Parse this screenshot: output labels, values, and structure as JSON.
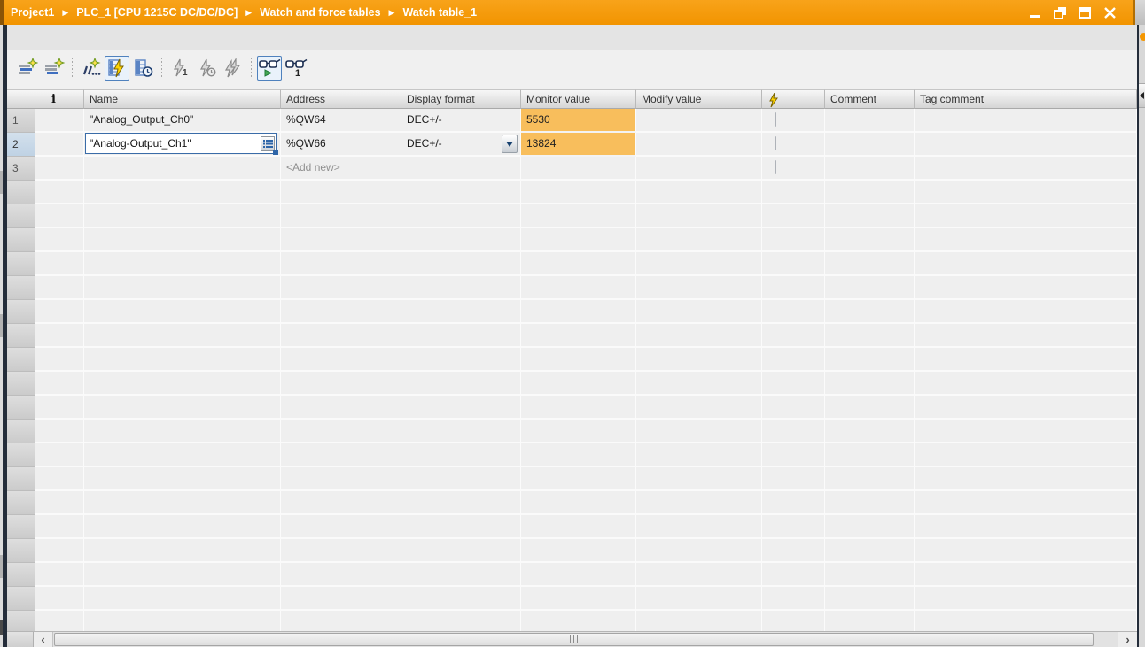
{
  "titlebar": {
    "breadcrumb": [
      "Project1",
      "PLC_1 [CPU 1215C DC/DC/DC]",
      "Watch and force tables",
      "Watch table_1"
    ],
    "separator": "▶"
  },
  "toolbar": {
    "buttons": [
      {
        "name": "insert-row",
        "icon": "rows-with-star-icon",
        "active": false
      },
      {
        "name": "add-row",
        "icon": "rows-with-star-icon",
        "active": false
      },
      {
        "name": "insert-multiple-rows",
        "icon": "italic-ll-dots-star-icon",
        "active": false
      },
      {
        "name": "monitor-all",
        "icon": "table-lightning-icon",
        "active": true
      },
      {
        "name": "monitor-once",
        "icon": "table-clock-icon",
        "active": false
      },
      {
        "name": "modify-once",
        "icon": "lightning-1-icon",
        "active": false
      },
      {
        "name": "modify-with-trigger",
        "icon": "lightning-clock-icon",
        "active": false
      },
      {
        "name": "modify-all",
        "icon": "double-lightning-icon",
        "active": false
      },
      {
        "name": "show-expanded-mode",
        "icon": "glasses-play-icon",
        "active": true
      },
      {
        "name": "show-force-columns",
        "icon": "glasses-1-icon",
        "active": false
      }
    ]
  },
  "table": {
    "headers": {
      "info": "i",
      "name": "Name",
      "address": "Address",
      "display_format": "Display format",
      "monitor_value": "Monitor value",
      "modify_value": "Modify value",
      "modify_trigger": "lightning-icon",
      "comment": "Comment",
      "tag_comment": "Tag comment"
    },
    "rows": [
      {
        "num": "1",
        "name": "\"Analog_Output_Ch0\"",
        "address": "%QW64",
        "display_format": "DEC+/-",
        "monitor_value": "5530"
      },
      {
        "num": "2",
        "name": "\"Analog-Output_Ch1\"",
        "address": "%QW66",
        "display_format": "DEC+/-",
        "monitor_value": "13824",
        "selected": true,
        "editing": true
      },
      {
        "num": "3",
        "address": "<Add new>"
      }
    ],
    "empty_row_count": 19
  },
  "colors": {
    "titlebar_orange": "#F29400",
    "monitor_value_highlight": "#F8BE5C",
    "active_button_border": "#4F81BD",
    "panel_edge_navy": "#242D3A",
    "selected_row_number_bg": "#C7D8E8"
  },
  "scrollbar": {
    "orientation": "horizontal",
    "left_arrow": "‹",
    "right_arrow": "›"
  }
}
